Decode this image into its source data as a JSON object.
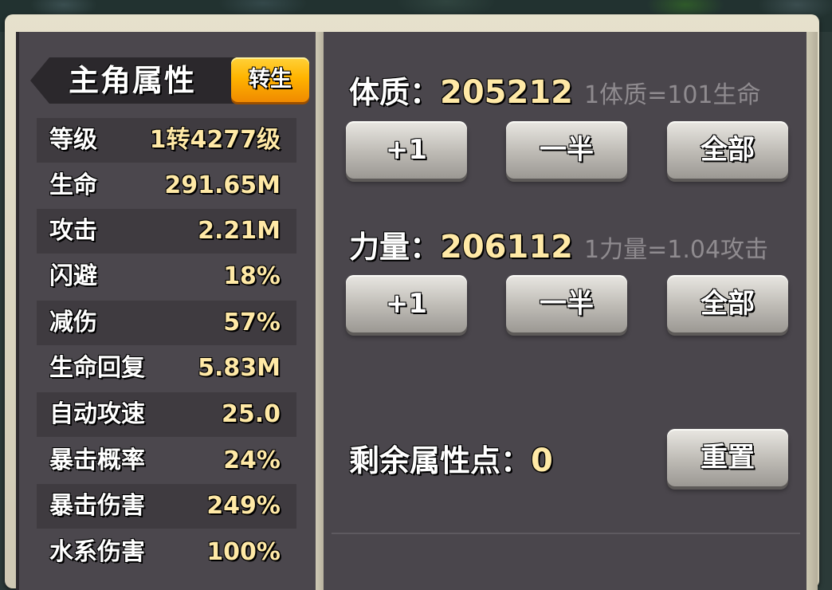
{
  "panel": {
    "title": "主角属性",
    "rebirth_label": "转生"
  },
  "stats": [
    {
      "label": "等级",
      "value": "1转4277级"
    },
    {
      "label": "生命",
      "value": "291.65M"
    },
    {
      "label": "攻击",
      "value": "2.21M"
    },
    {
      "label": "闪避",
      "value": "18%"
    },
    {
      "label": "减伤",
      "value": "57%"
    },
    {
      "label": "生命回复",
      "value": "5.83M"
    },
    {
      "label": "自动攻速",
      "value": "25.0"
    },
    {
      "label": "暴击概率",
      "value": "24%"
    },
    {
      "label": "暴击伤害",
      "value": "249%"
    },
    {
      "label": "水系伤害",
      "value": "100%"
    }
  ],
  "constitution": {
    "name": "体质：",
    "value": "205212",
    "note": "1体质=101生命",
    "buttons": {
      "plus_one": "+1",
      "half": "一半",
      "all": "全部"
    }
  },
  "strength": {
    "name": "力量：",
    "value": "206112",
    "note": "1力量=1.04攻击",
    "buttons": {
      "plus_one": "+1",
      "half": "一半",
      "all": "全部"
    }
  },
  "remaining": {
    "label": "剩余属性点：",
    "value": "0",
    "reset_label": "重置"
  },
  "colors": {
    "value_text": "#ffe9a6",
    "rebirth_button": "#ffb400",
    "panel_bg": "#4a464c"
  }
}
